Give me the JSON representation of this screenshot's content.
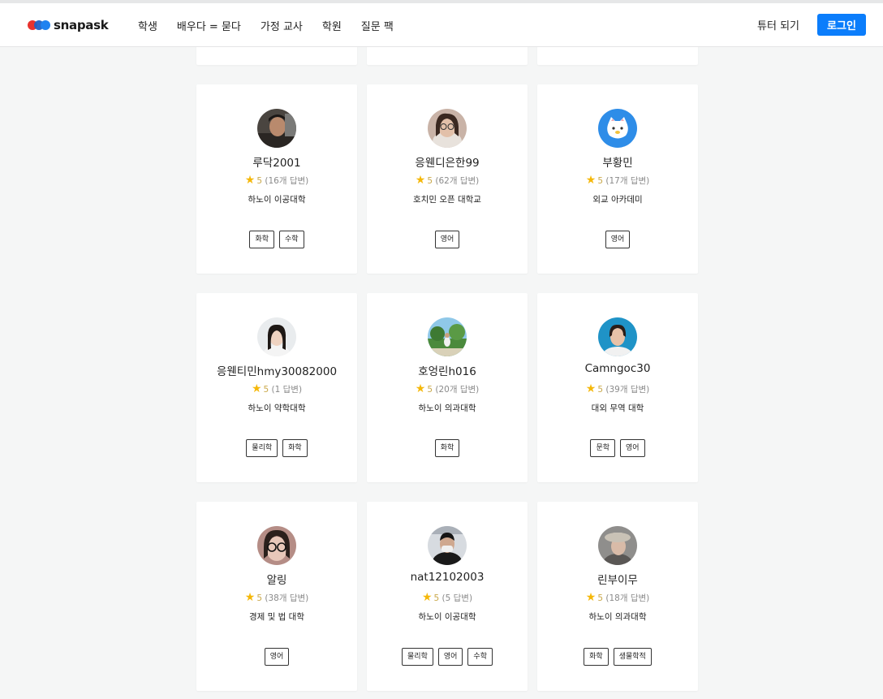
{
  "brand": {
    "name": "snapask"
  },
  "nav": {
    "links": [
      "학생",
      "배우다 = 묻다",
      "가정 교사",
      "학원",
      "질문 팩"
    ],
    "tutor_link": "튜터 되기",
    "login_label": "로그인"
  },
  "colors": {
    "accent": "#0b7dfb",
    "star": "#f5b80a",
    "background": "#f5f6f6"
  },
  "tutors": [
    {
      "name": "루닥2001",
      "score": "5",
      "answers": "(16개 답변)",
      "school": "하노이 이공대학",
      "tags": [
        "화학",
        "수학"
      ],
      "avatar": "photo-male-dark"
    },
    {
      "name": "응웬디은한99",
      "score": "5",
      "answers": "(62개 답변)",
      "school": "호치민 오픈 대학교",
      "tags": [
        "영어"
      ],
      "avatar": "photo-female-glasses"
    },
    {
      "name": "부황민",
      "score": "5",
      "answers": "(17개 답변)",
      "school": "외교 아카데미",
      "tags": [
        "영어"
      ],
      "avatar": "cartoon-cat-icon"
    },
    {
      "name": "응웬티민hmy30082000",
      "score": "5",
      "answers": "(1 답변)",
      "school": "하노이 약학대학",
      "tags": [
        "물리학",
        "화학"
      ],
      "avatar": "photo-female-light"
    },
    {
      "name": "호엉린h016",
      "score": "5",
      "answers": "(20개 답변)",
      "school": "하노이 의과대학",
      "tags": [
        "화학"
      ],
      "avatar": "photo-outdoor"
    },
    {
      "name": "Camngoc30",
      "score": "5",
      "answers": "(39개 답변)",
      "school": "대외 무역 대학",
      "tags": [
        "문학",
        "영어"
      ],
      "avatar": "photo-female-blue"
    },
    {
      "name": "알링",
      "score": "5",
      "answers": "(38개 답변)",
      "school": "경제 및 법 대학",
      "tags": [
        "영어"
      ],
      "avatar": "photo-female-glasses-2"
    },
    {
      "name": "nat12102003",
      "score": "5",
      "answers": "(5 답변)",
      "school": "하노이 이공대학",
      "tags": [
        "물리학",
        "영어",
        "수학"
      ],
      "avatar": "photo-male-mask"
    },
    {
      "name": "린부이무",
      "score": "5",
      "answers": "(18개 답변)",
      "school": "하노이 의과대학",
      "tags": [
        "화학",
        "생물학적"
      ],
      "avatar": "photo-female-hat"
    }
  ]
}
